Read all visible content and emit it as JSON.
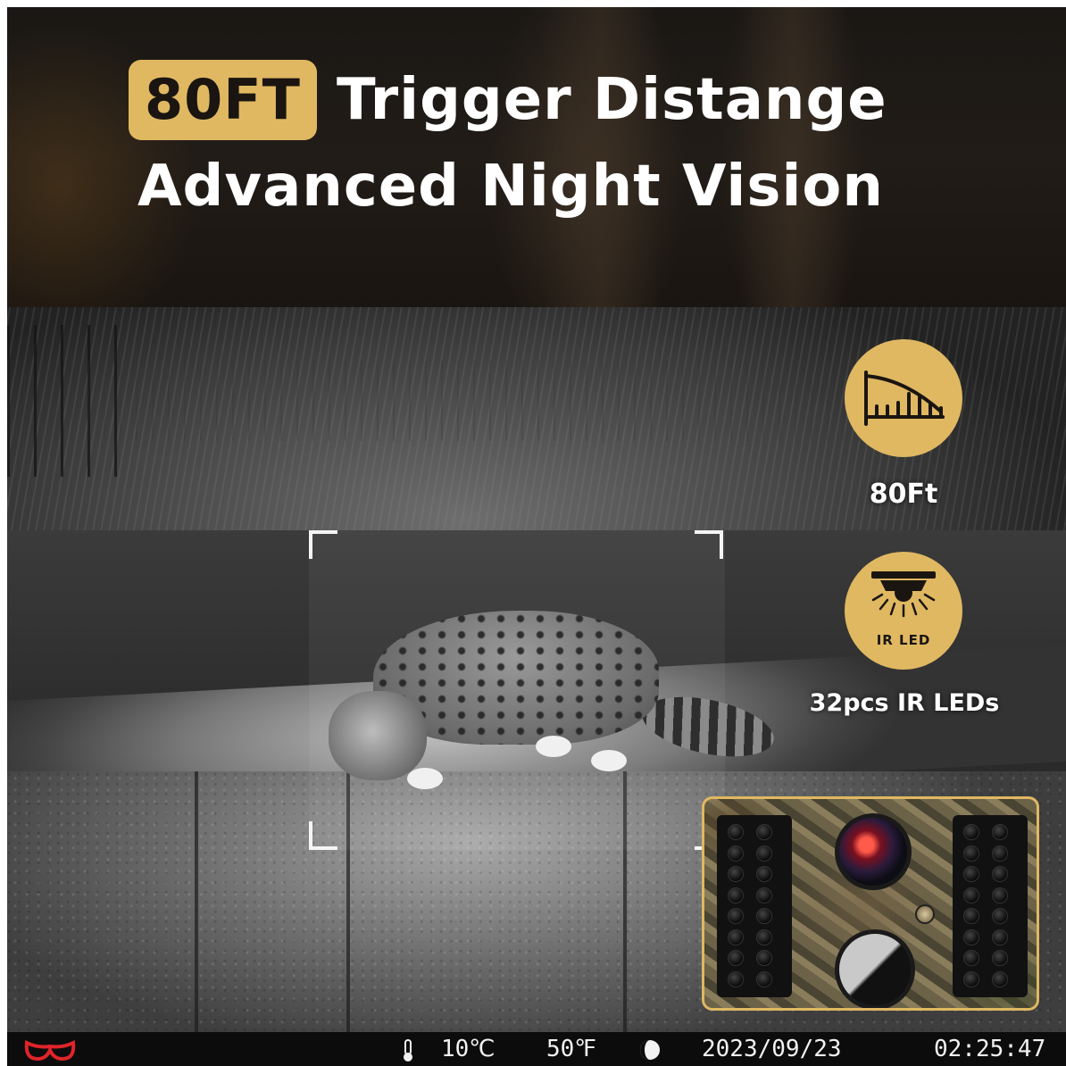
{
  "header": {
    "badge": "80FT",
    "title_line1": "Trigger Distange",
    "title_line2": "Advanced Night Vision"
  },
  "features": {
    "trigger_distance": {
      "icon": "distance-ruler-icon",
      "label": "80Ft"
    },
    "ir_led": {
      "icon": "ir-led-icon",
      "icon_text": "IR LED",
      "label": "32pcs IR LEDs"
    }
  },
  "status_bar": {
    "logo": "brand-logo-icon",
    "temp_icon": "thermometer-icon",
    "temp_c": "10℃",
    "temp_f": "50℉",
    "moon_icon": "moon-phase-icon",
    "date": "2023/09/23",
    "time": "02:25:47"
  },
  "colors": {
    "accent": "#e0b862",
    "text": "#ffffff",
    "status_bar_bg": "#0c0c0c",
    "logo_red": "#e0242a"
  }
}
